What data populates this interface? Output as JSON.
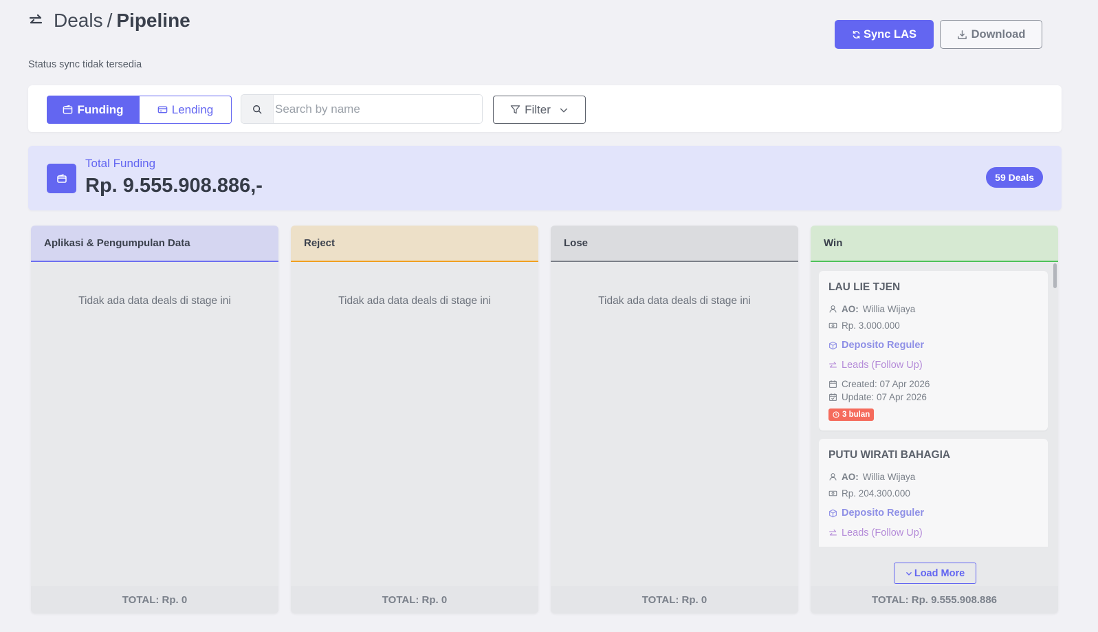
{
  "header": {
    "breadcrumb_parent": "Deals",
    "breadcrumb_separator": "/",
    "breadcrumb_current": "Pipeline",
    "status_text": "Status sync tidak tersedia",
    "sync_label": "Sync LAS",
    "download_label": "Download"
  },
  "toolbar": {
    "tabs": [
      {
        "label": "Funding",
        "active": true
      },
      {
        "label": "Lending",
        "active": false
      }
    ],
    "search": {
      "placeholder": "Search by name",
      "value": ""
    },
    "filter_label": "Filter"
  },
  "summary": {
    "label": "Total Funding",
    "amount": "Rp. 9.555.908.886,-",
    "deals_badge": "59 Deals"
  },
  "columns": [
    {
      "title": "Aplikasi & Pengumpulan Data",
      "empty_text": "Tidak ada data deals di stage ini",
      "total": "TOTAL: Rp. 0"
    },
    {
      "title": "Reject",
      "empty_text": "Tidak ada data deals di stage ini",
      "total": "TOTAL: Rp. 0"
    },
    {
      "title": "Lose",
      "empty_text": "Tidak ada data deals di stage ini",
      "total": "TOTAL: Rp. 0"
    },
    {
      "title": "Win",
      "total": "TOTAL: Rp. 9.555.908.886",
      "load_more_label": "Load More",
      "cards": [
        {
          "name": "LAU LIE TJEN",
          "ao_label": "AO:",
          "ao_name": "Willia Wijaya",
          "amount": "Rp. 3.000.000",
          "product": "Deposito Reguler",
          "stage": "Leads (Follow Up)",
          "created": "Created: 07 Apr 2026",
          "updated": "Update: 07 Apr 2026",
          "age_badge": "3 bulan"
        },
        {
          "name": "PUTU WIRATI BAHAGIA",
          "ao_label": "AO:",
          "ao_name": "Willia Wijaya",
          "amount": "Rp. 204.300.000",
          "product": "Deposito Reguler",
          "stage": "Leads (Follow Up)"
        }
      ]
    }
  ],
  "colors": {
    "accent": "#6366f1",
    "col1_border": "#6d6ff0",
    "col2_border": "#f0a020",
    "col3_border": "#7b8088",
    "col4_border": "#4fc25a",
    "age_badge": "#f56b5c"
  }
}
